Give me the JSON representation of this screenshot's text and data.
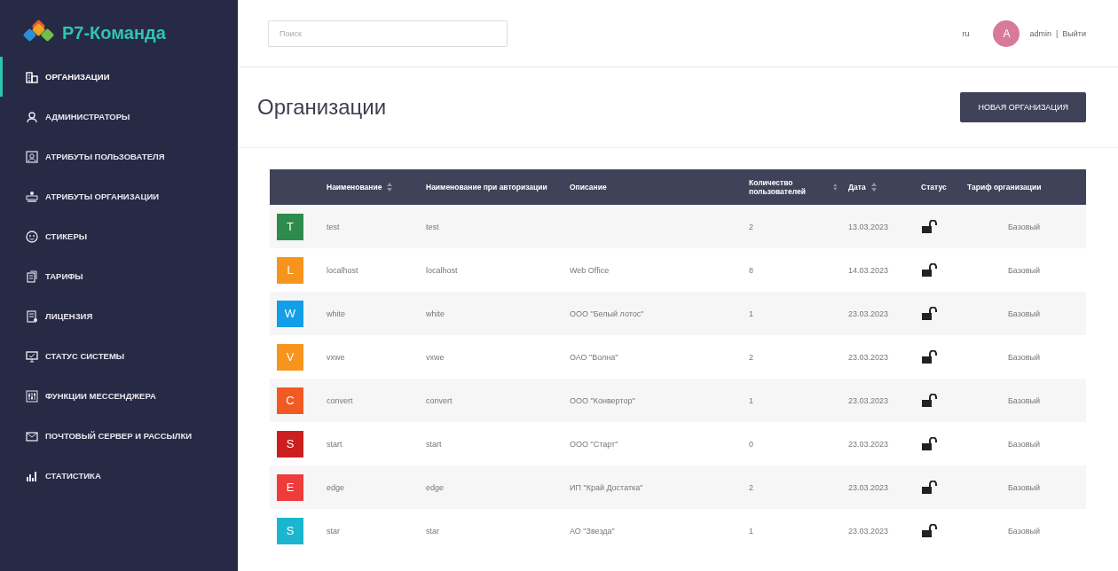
{
  "sidebar": {
    "logo": "Р7-Команда",
    "items": [
      {
        "label": "ОРГАНИЗАЦИИ",
        "selected": true
      },
      {
        "label": "АДМИНИСТРАТОРЫ",
        "selected": false
      },
      {
        "label": "АТРИБУТЫ ПОЛЬЗОВАТЕЛЯ",
        "selected": false
      },
      {
        "label": "АТРИБУТЫ ОРГАНИЗАЦИИ",
        "selected": false
      },
      {
        "label": "СТИКЕРЫ",
        "selected": false
      },
      {
        "label": "ТАРИФЫ",
        "selected": false
      },
      {
        "label": "ЛИЦЕНЗИЯ",
        "selected": false
      },
      {
        "label": "СТАТУС СИСТЕМЫ",
        "selected": false
      },
      {
        "label": "ФУНКЦИИ МЕССЕНДЖЕРА",
        "selected": false
      },
      {
        "label": "ПОЧТОВЫЙ СЕРВЕР И РАССЫЛКИ",
        "selected": false
      },
      {
        "label": "СТАТИСТИКА",
        "selected": false
      }
    ]
  },
  "topbar": {
    "search": {
      "placeholder": "Поиск"
    },
    "language": "ru",
    "user": {
      "avatar": "A",
      "name": "admin",
      "separator": "|",
      "logout": "Выйти"
    }
  },
  "page": {
    "title": "Организации",
    "new_button": "НОВАЯ ОРГАНИЗАЦИЯ"
  },
  "table": {
    "columns": [
      {
        "label": "Наименование",
        "sortable": true
      },
      {
        "label": "Наименование при авторизации",
        "sortable": false
      },
      {
        "label": "Описание",
        "sortable": false
      },
      {
        "label": "Количество пользователей",
        "sortable": true
      },
      {
        "label": "Дата",
        "sortable": true
      },
      {
        "label": "Статус",
        "sortable": false
      },
      {
        "label": "Тариф организации",
        "sortable": false
      }
    ],
    "rows": [
      {
        "letter": "T",
        "color": "#2e8b4e",
        "name": "test",
        "login": "test",
        "description": "",
        "users": "2",
        "date": "13.03.2023",
        "locked": false,
        "tariff": "Базовый"
      },
      {
        "letter": "L",
        "color": "#f7941d",
        "name": "localhost",
        "login": "localhost",
        "description": "Web Office",
        "users": "8",
        "date": "14.03.2023",
        "locked": false,
        "tariff": "Базовый"
      },
      {
        "letter": "W",
        "color": "#139ee8",
        "name": "white",
        "login": "white",
        "description": "ООО \"Белый лотос\"",
        "users": "1",
        "date": "23.03.2023",
        "locked": false,
        "tariff": "Базовый"
      },
      {
        "letter": "V",
        "color": "#f7941d",
        "name": "vxwe",
        "login": "vxwe",
        "description": "ОАО \"Волна\"",
        "users": "2",
        "date": "23.03.2023",
        "locked": false,
        "tariff": "Базовый"
      },
      {
        "letter": "C",
        "color": "#f15a22",
        "name": "convert",
        "login": "convert",
        "description": "ООО \"Конвертор\"",
        "users": "1",
        "date": "23.03.2023",
        "locked": false,
        "tariff": "Базовый"
      },
      {
        "letter": "S",
        "color": "#cc1f1f",
        "name": "start",
        "login": "start",
        "description": "ООО \"Старт\"",
        "users": "0",
        "date": "23.03.2023",
        "locked": false,
        "tariff": "Базовый"
      },
      {
        "letter": "E",
        "color": "#ee3b3b",
        "name": "edge",
        "login": "edge",
        "description": "ИП \"Край Достатка\"",
        "users": "2",
        "date": "23.03.2023",
        "locked": false,
        "tariff": "Базовый"
      },
      {
        "letter": "S",
        "color": "#1bb5cf",
        "name": "star",
        "login": "star",
        "description": "АО \"Звезда\"",
        "users": "1",
        "date": "23.03.2023",
        "locked": false,
        "tariff": "Базовый"
      }
    ]
  }
}
